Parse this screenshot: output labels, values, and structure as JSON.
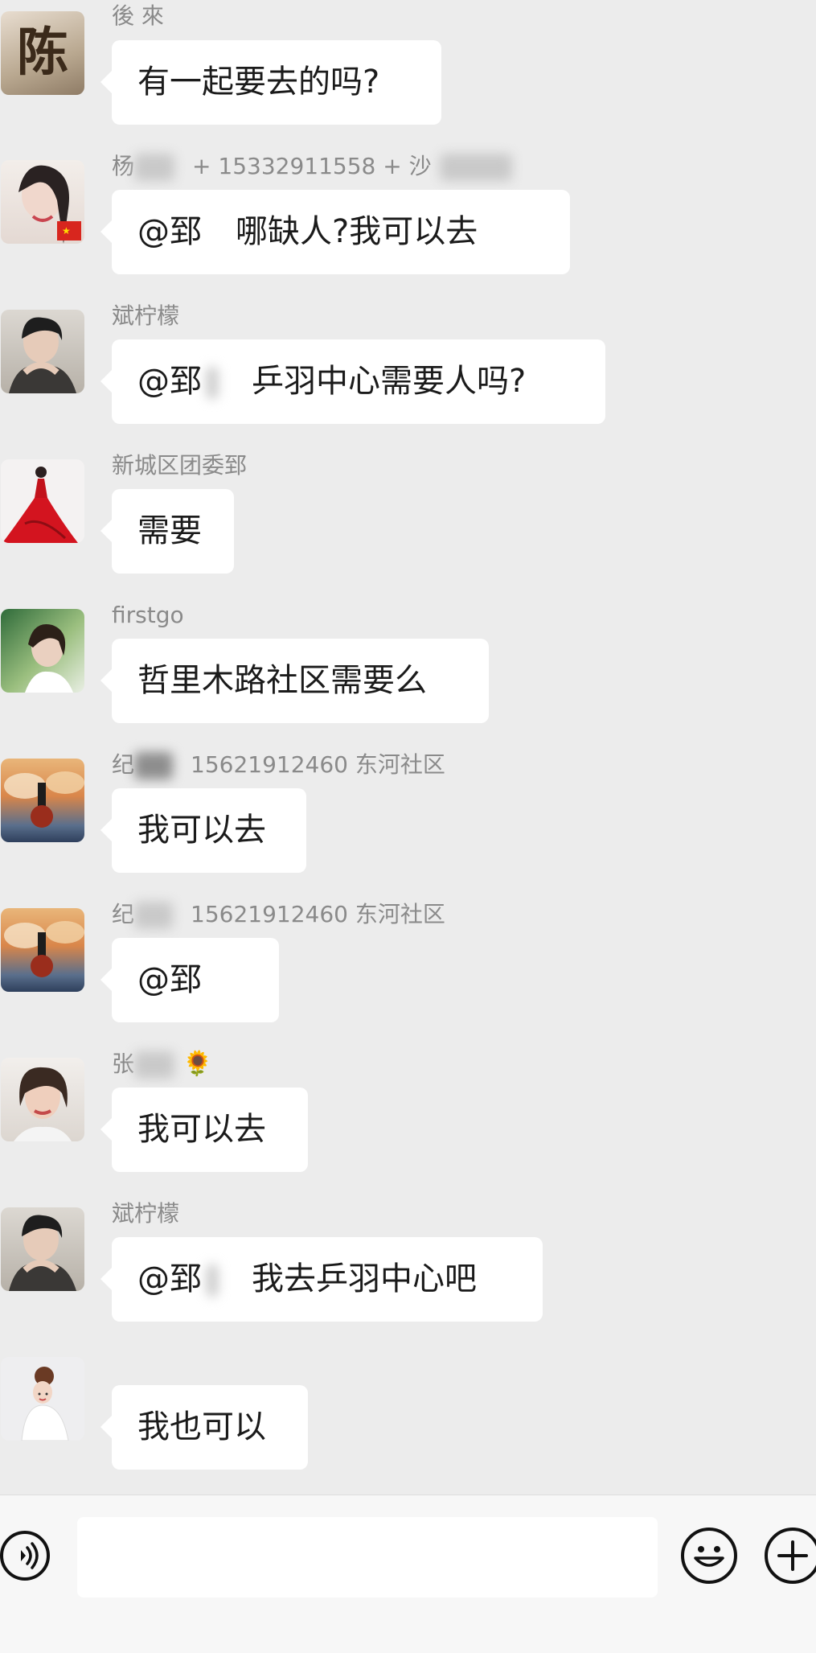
{
  "messages": [
    {
      "sender": "後 來",
      "extra": "",
      "emoji": "",
      "avatar": "avatar-chen",
      "text": "有一起要去的吗?",
      "rest": ""
    },
    {
      "sender": "杨",
      "extra": "+ 15332911558 + 沙",
      "emoji": "",
      "avatar": "avatar-woman-flag",
      "text": "@郅",
      "rest": "哪缺人?我可以去"
    },
    {
      "sender": "斌柠檬",
      "extra": "",
      "emoji": "",
      "avatar": "avatar-woman-dark",
      "text": "@郅",
      "rest": "乒羽中心需要人吗?"
    },
    {
      "sender": "新城区团委郅",
      "extra": "",
      "emoji": "",
      "avatar": "avatar-red-dress",
      "text": "需要",
      "rest": ""
    },
    {
      "sender": "firstgo",
      "extra": "",
      "emoji": "",
      "avatar": "avatar-green",
      "text": "哲里木路社区需要么",
      "rest": ""
    },
    {
      "sender": "纪",
      "extra": "15621912460 东河社区",
      "emoji": "",
      "avatar": "avatar-sunset",
      "text": "我可以去",
      "rest": ""
    },
    {
      "sender": "纪",
      "extra": "15621912460 东河社区",
      "emoji": "",
      "avatar": "avatar-sunset",
      "text": "@郅",
      "rest": ""
    },
    {
      "sender": "张",
      "extra": "",
      "emoji": "🌻",
      "avatar": "avatar-woman-light",
      "text": "我可以去",
      "rest": ""
    },
    {
      "sender": "斌柠檬",
      "extra": "",
      "emoji": "",
      "avatar": "avatar-woman-dark",
      "text": "@郅",
      "rest": "我去乒羽中心吧"
    },
    {
      "sender": "",
      "extra": "",
      "emoji": "",
      "avatar": "avatar-bride",
      "text": "我也可以",
      "rest": ""
    }
  ],
  "avatars": {
    "avatar-chen": {
      "label": "陈"
    }
  },
  "input_bar": {
    "input_value": "",
    "icons": {
      "voice": "voice-icon",
      "emoji": "smiley-icon",
      "more": "plus-icon"
    }
  }
}
